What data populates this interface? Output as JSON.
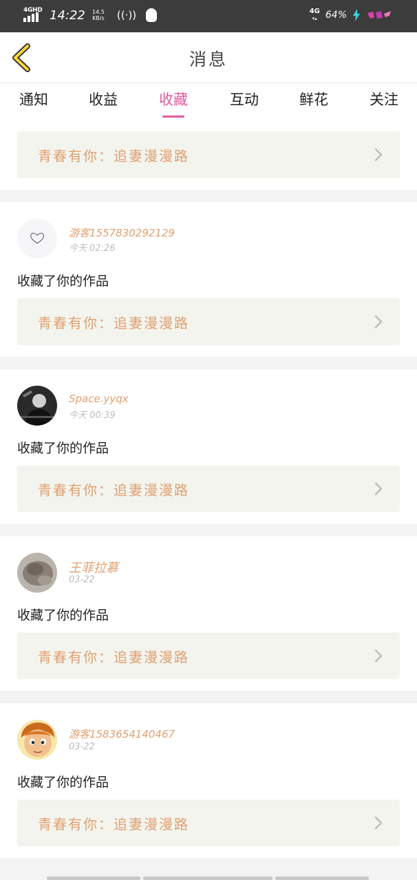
{
  "status_bar": {
    "signal_label": "4GHD",
    "time": "14:22",
    "speed_value": "14.5",
    "speed_unit": "KB/s",
    "hotspot_icon": "((·))",
    "net_label": "4G",
    "battery": "64%"
  },
  "nav": {
    "title": "消息"
  },
  "tabs": [
    {
      "label": "通知",
      "active": false
    },
    {
      "label": "收益",
      "active": false
    },
    {
      "label": "收藏",
      "active": true
    },
    {
      "label": "互动",
      "active": false
    },
    {
      "label": "鲜花",
      "active": false
    },
    {
      "label": "关注",
      "active": false
    }
  ],
  "top_card": {
    "work_title": "青春有你：追妻漫漫路"
  },
  "notifications": [
    {
      "user": "游客15578302921​29",
      "time": "今天 02:26",
      "message": "收藏了你的作品",
      "work_title": "青春有你：追妻漫漫路",
      "avatar": "heart-placeholder"
    },
    {
      "user": "Space.yyqx",
      "time": "今天 00:39",
      "message": "收藏了你的作品",
      "work_title": "青春有你：追妻漫漫路",
      "avatar": "photo-dark"
    },
    {
      "user": "王菲拉慕",
      "time": "03-22",
      "message": "收藏了你的作品",
      "work_title": "青春有你：追妻漫漫路",
      "avatar": "photo-blur"
    },
    {
      "user": "游客15836541404​67",
      "time": "03-22",
      "message": "收藏了你的作品",
      "work_title": "青春有你：追妻漫漫路",
      "avatar": "cartoon-boy"
    }
  ],
  "colors": {
    "accent": "#e05a9e",
    "link_text": "#e0a070",
    "card_bg": "#f3f4ee"
  }
}
